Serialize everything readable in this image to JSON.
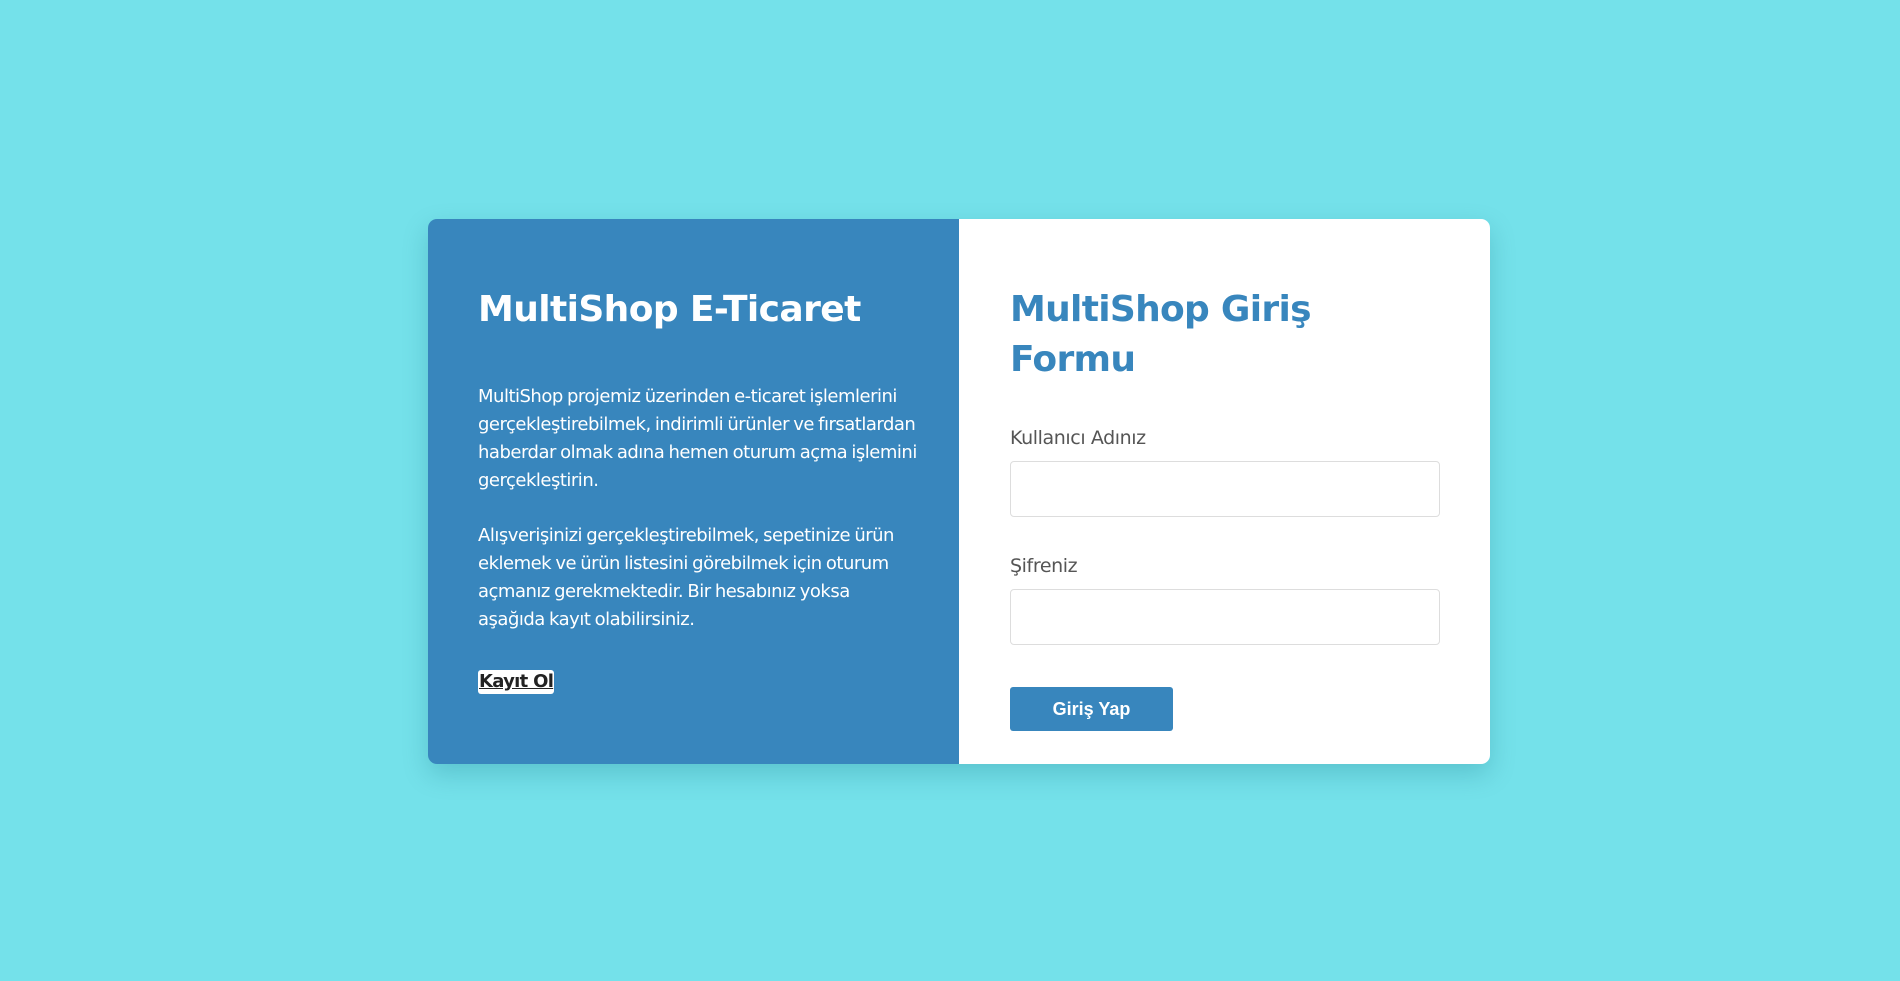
{
  "left_panel": {
    "title": "MultiShop E-Ticaret",
    "paragraph_1": "MultiShop projemiz üzerinden e-ticaret işlemlerini gerçekleştirebilmek, indirimli ürünler ve fırsatlardan haberdar olmak adına hemen oturum açma işlemini gerçekleştirin.",
    "paragraph_2": "Alışverişinizi gerçekleştirebilmek, sepetinize ürün eklemek ve ürün listesini görebilmek için oturum açmanız gerekmektedir. Bir hesabınız yoksa aşağıda kayıt olabilirsiniz.",
    "register_link": "Kayıt Ol"
  },
  "login_form": {
    "title": "MultiShop Giriş Formu",
    "username_label": "Kullanıcı Adınız",
    "username_value": "",
    "password_label": "Şifreniz",
    "password_value": "",
    "submit_label": "Giriş Yap"
  },
  "colors": {
    "background": "#74e1ea",
    "accent": "#3886bd",
    "card_right": "#ffffff"
  }
}
